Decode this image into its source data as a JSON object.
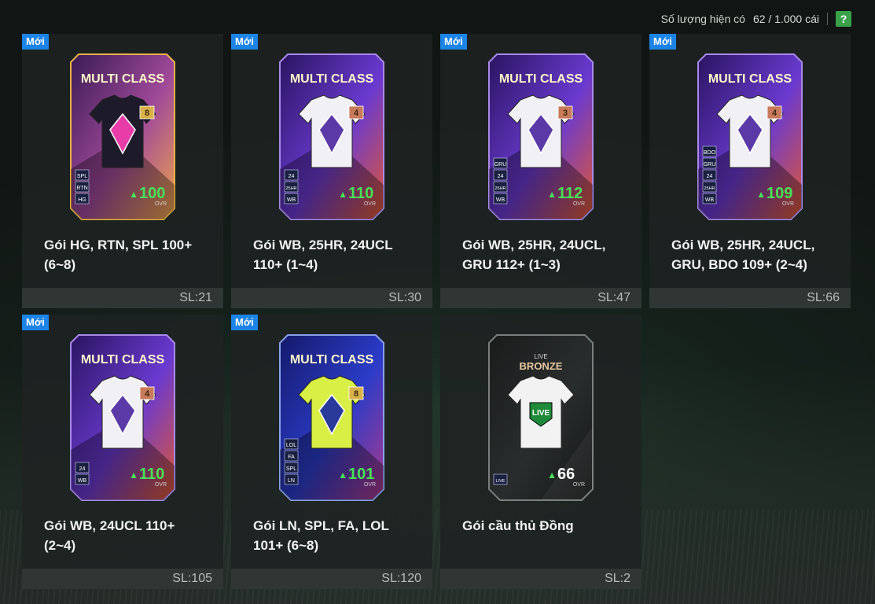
{
  "header": {
    "label": "Số lượng hiện có",
    "count": "62 / 1.000 cái",
    "help_label": "?"
  },
  "packs": [
    {
      "badge": "Mới",
      "title": "Gói HG, RTN, SPL 100+ (6~8)",
      "qty": "SL:21",
      "card": {
        "header": "MULTI CLASS",
        "num": "8",
        "ovr": "100",
        "ovr_label": "OVR",
        "tags": [
          "SPL",
          "RTN",
          "HG"
        ],
        "theme": "gold"
      }
    },
    {
      "badge": "Mới",
      "title": "Gói WB, 25HR, 24UCL 110+ (1~4)",
      "qty": "SL:30",
      "card": {
        "header": "MULTI CLASS",
        "num": "4",
        "ovr": "110",
        "ovr_label": "OVR",
        "tags": [
          "24",
          "25HR",
          "WB"
        ],
        "theme": "purple"
      }
    },
    {
      "badge": "Mới",
      "title": "Gói WB, 25HR, 24UCL, GRU 112+ (1~3)",
      "qty": "SL:47",
      "card": {
        "header": "MULTI CLASS",
        "num": "3",
        "ovr": "112",
        "ovr_label": "OVR",
        "tags": [
          "GRU",
          "24",
          "25HR",
          "WB"
        ],
        "theme": "purple"
      }
    },
    {
      "badge": "Mới",
      "title": "Gói WB, 25HR, 24UCL, GRU, BDO 109+ (2~4)",
      "qty": "SL:66",
      "card": {
        "header": "MULTI CLASS",
        "num": "4",
        "ovr": "109",
        "ovr_label": "OVR",
        "tags": [
          "BDO",
          "GRU",
          "24",
          "25HR",
          "WB"
        ],
        "theme": "purple"
      }
    },
    {
      "badge": "Mới",
      "title": "Gói WB, 24UCL 110+ (2~4)",
      "qty": "SL:105",
      "card": {
        "header": "MULTI CLASS",
        "num": "4",
        "ovr": "110",
        "ovr_label": "OVR",
        "tags": [
          "24",
          "WB"
        ],
        "theme": "purple"
      }
    },
    {
      "badge": "Mới",
      "title": "Gói LN, SPL, FA, LOL 101+ (6~8)",
      "qty": "SL:120",
      "card": {
        "header": "MULTI CLASS",
        "num": "8",
        "ovr": "101",
        "ovr_label": "OVR",
        "tags": [
          "LOL",
          "FA",
          "SPL",
          "LN"
        ],
        "theme": "blue"
      }
    },
    {
      "badge": "",
      "title": "Gói cầu thủ Đồng",
      "qty": "SL:2",
      "card": {
        "header": "BRONZE",
        "sub": "LIVE",
        "num": "",
        "ovr": "66",
        "ovr_label": "OVR",
        "tags": [
          "LIVE"
        ],
        "theme": "dark",
        "shirt_label": "LIVE"
      }
    }
  ],
  "colors": {
    "badge": "#1c84e6",
    "ovr_green": "#49e05a",
    "help": "#3aa14a"
  }
}
